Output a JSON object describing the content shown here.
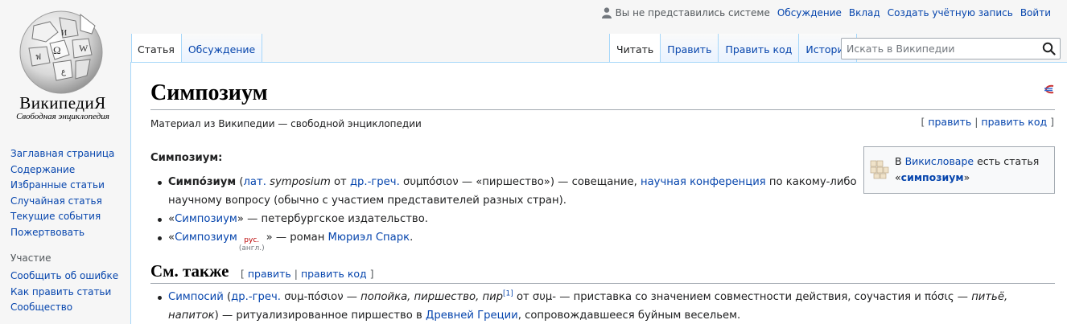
{
  "site": {
    "wordmark": "ВикипедиЯ",
    "tagline": "Свободная энциклопедия"
  },
  "sidebar": {
    "items": [
      "Заглавная страница",
      "Содержание",
      "Избранные статьи",
      "Случайная статья",
      "Текущие события",
      "Пожертвовать"
    ],
    "portal_heading": "Участие",
    "portal_items": [
      "Сообщить об ошибке",
      "Как править статьи",
      "Сообщество"
    ]
  },
  "personal": {
    "not_logged_in": "Вы не представились системе",
    "talk": "Обсуждение",
    "contributions": "Вклад",
    "create_account": "Создать учётную запись",
    "login": "Войти"
  },
  "tabs_left": [
    "Статья",
    "Обсуждение"
  ],
  "tabs_right": [
    "Читать",
    "Править",
    "Править код",
    "История"
  ],
  "search": {
    "placeholder": "Искать в Википедии"
  },
  "page": {
    "title": "Симпозиум",
    "subtitle": "Материал из Википедии — свободной энциклопедии",
    "edit": "править",
    "edit_code": "править код",
    "lead": "Симпозиум:",
    "items": [
      {
        "term": "Симпо́зиум",
        "open": " (",
        "lat_link": "лат.",
        "lat_word": "symposium",
        "from": " от ",
        "greek_link": "др.-греч.",
        "greek_word": " συμπόσιον",
        "meaning": " — «пиршество») — совещание, ",
        "conf_link": "научная конференция",
        "rest": " по какому-либо научному вопросу (обычно с участием представителей разных стран)."
      },
      {
        "open": "«",
        "link": "Симпозиум",
        "rest": "» — петербургское издательство."
      },
      {
        "open": "«",
        "link": "Симпозиум",
        "ru": "рус.",
        "en": "(англ.)",
        "mid": "» — роман ",
        "author": "Мюриэл Спарк",
        "end": "."
      }
    ],
    "wiktionary": {
      "pre": "В ",
      "link": "Викисловаре",
      "mid": " есть статья",
      "open": "«",
      "word": "симпозиум",
      "close": "»"
    },
    "see_also": {
      "heading": "См. также",
      "term": "Симпосий",
      "open": " (",
      "greek_link": "др.-греч.",
      "greek_word": " συμ-πόσιον",
      "dash": " — ",
      "meaning_it": "попойка, пиршество, пир",
      "ref": "[1]",
      "text1": " от συμ- — приставка со значением совместности действия, соучастия и πόσις — ",
      "meaning2_it": "питьё, напиток",
      "text2": ") — ритуализированное пиршество в ",
      "greece_link": "Древней Греции",
      "text3": ", сопровождавшееся буйным весельем."
    }
  }
}
